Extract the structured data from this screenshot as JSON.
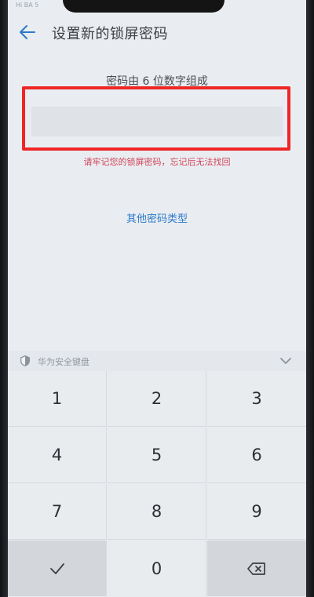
{
  "status_bar": {
    "left_text": "Hi BA 5"
  },
  "header": {
    "back_icon": "back-arrow-icon",
    "title": "设置新的锁屏密码"
  },
  "main": {
    "prompt": "密码由 6 位数字组成",
    "password_value": "",
    "warning": "请牢记您的锁屏密码，忘记后无法找回",
    "other_link": "其他密码类型"
  },
  "keyboard": {
    "label": "华为安全键盘",
    "shield_icon": "shield-icon",
    "collapse_icon": "chevron-down-icon",
    "keys": [
      {
        "label": "1",
        "type": "digit"
      },
      {
        "label": "2",
        "type": "digit"
      },
      {
        "label": "3",
        "type": "digit"
      },
      {
        "label": "4",
        "type": "digit"
      },
      {
        "label": "5",
        "type": "digit"
      },
      {
        "label": "6",
        "type": "digit"
      },
      {
        "label": "7",
        "type": "digit"
      },
      {
        "label": "8",
        "type": "digit"
      },
      {
        "label": "9",
        "type": "digit"
      },
      {
        "label": "",
        "type": "confirm",
        "icon": "checkmark-icon"
      },
      {
        "label": "0",
        "type": "digit"
      },
      {
        "label": "",
        "type": "delete",
        "icon": "backspace-icon"
      }
    ]
  },
  "colors": {
    "accent": "#2d79c9",
    "warning": "#d2445a",
    "highlight": "#ef2626",
    "screen_bg": "#e9edf1"
  }
}
